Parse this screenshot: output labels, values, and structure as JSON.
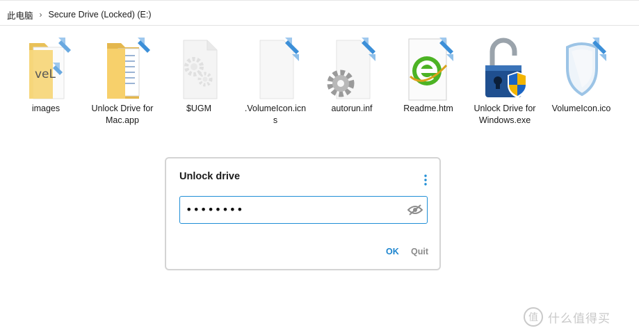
{
  "breadcrumb": {
    "root": "此电脑",
    "separator": "›",
    "drive": "Secure Drive (Locked) (E:)"
  },
  "files": [
    {
      "label": "images",
      "icon": "folder-icon"
    },
    {
      "label": "Unlock Drive for Mac.app",
      "icon": "folder-icon"
    },
    {
      "label": "$UGM",
      "icon": "gear-file-icon"
    },
    {
      "label": ".VolumeIcon.icns",
      "icon": "blank-file-icon"
    },
    {
      "label": "autorun.inf",
      "icon": "settings-file-icon"
    },
    {
      "label": "Readme.htm",
      "icon": "browser-file-icon"
    },
    {
      "label": "Unlock Drive for Windows.exe",
      "icon": "padlock-shield-icon"
    },
    {
      "label": "VolumeIcon.ico",
      "icon": "shield-icon"
    }
  ],
  "dialog": {
    "title": "Unlock drive",
    "password_value": "••••••••",
    "ok_label": "OK",
    "quit_label": "Quit"
  },
  "watermark": {
    "text": "什么值得买",
    "logo_glyph": "值"
  },
  "colors": {
    "accent": "#1f8ed6",
    "ok_text": "#1d85cf",
    "quit_text": "#8a8a8a",
    "folder": "#f5cf6b",
    "shortcut_arrow": "#4a9fe0"
  }
}
